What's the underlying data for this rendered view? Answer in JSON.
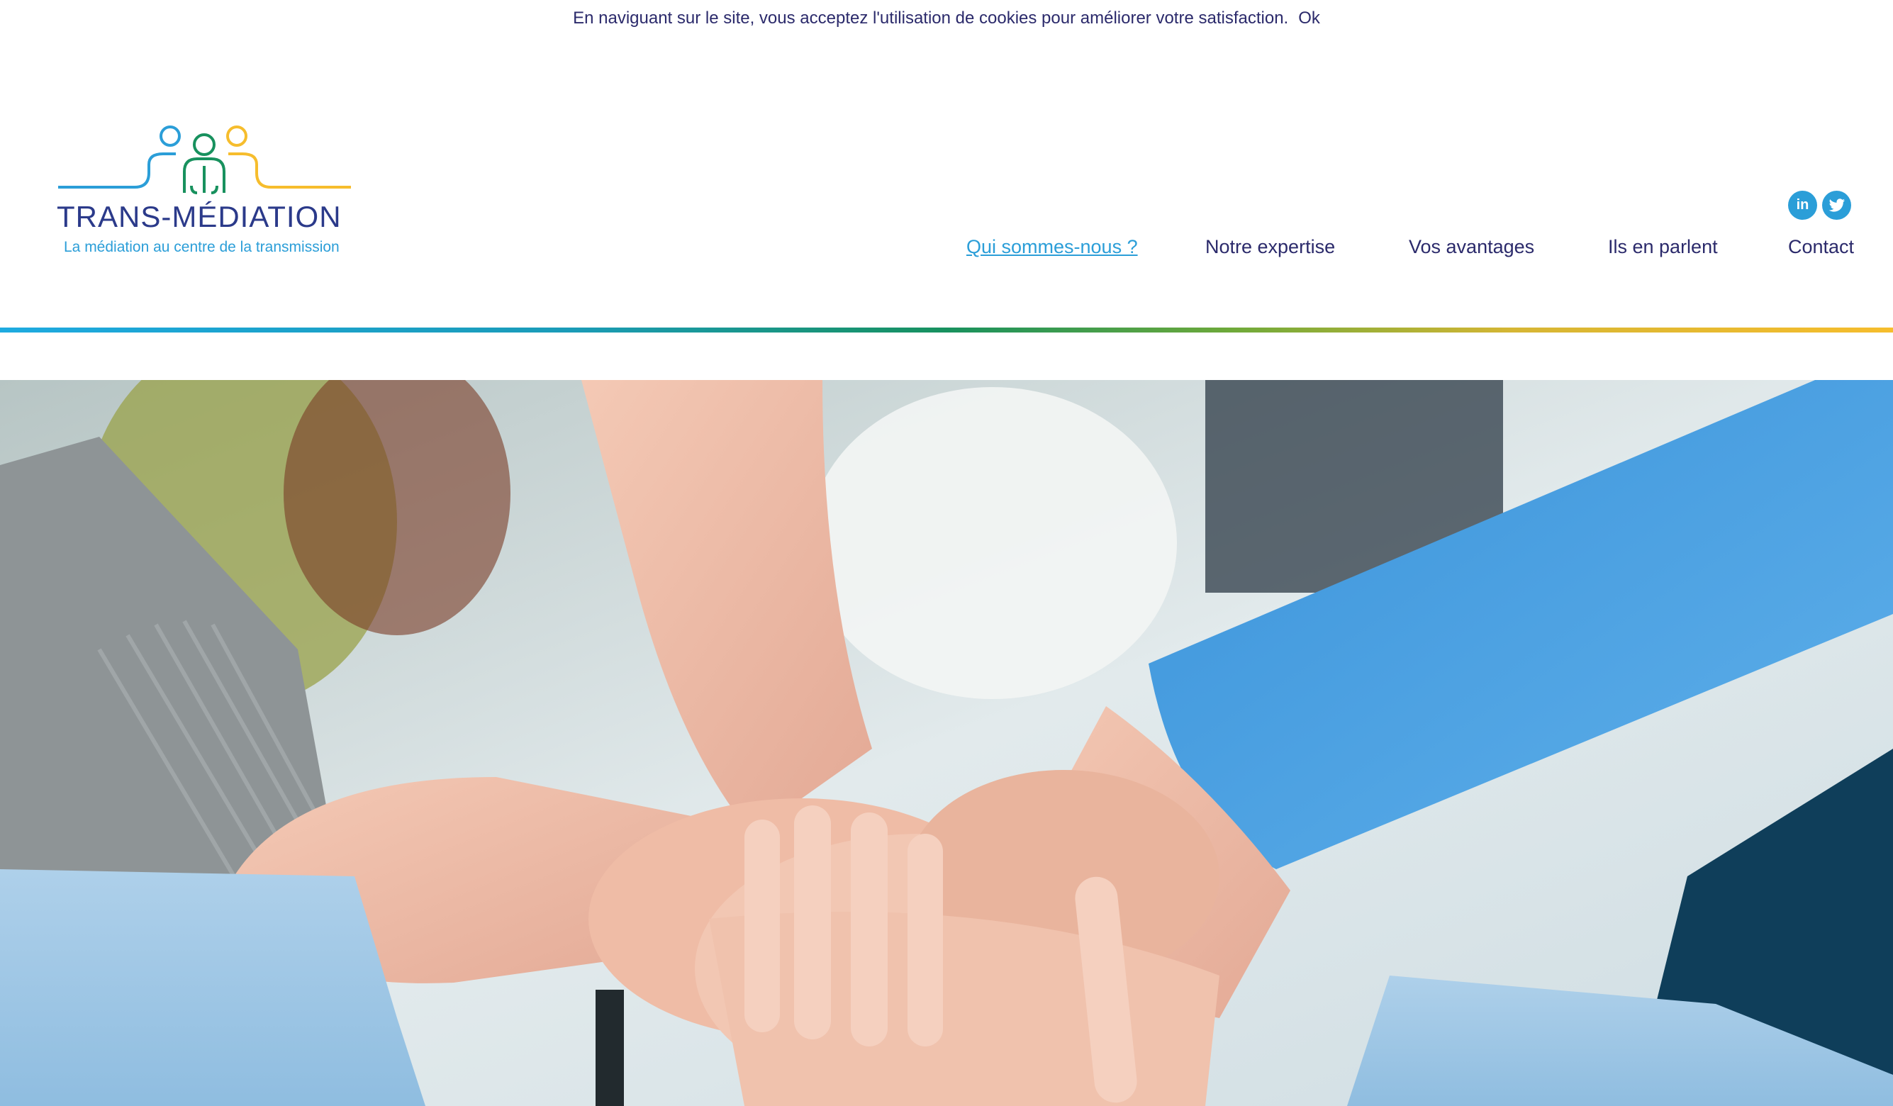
{
  "cookie_banner": {
    "message": "En naviguant sur le site, vous acceptez l'utilisation de cookies pour améliorer votre satisfaction.",
    "ok_label": "Ok"
  },
  "logo": {
    "title": "TRANS-MÉDIATION",
    "tagline": "La médiation au centre de la transmission"
  },
  "social": {
    "linkedin_icon": "linkedin-icon",
    "linkedin_label": "in",
    "twitter_icon": "twitter-icon"
  },
  "nav": {
    "items": [
      {
        "label": "Qui sommes-nous ?",
        "active": true
      },
      {
        "label": "Notre expertise",
        "active": false
      },
      {
        "label": "Vos avantages",
        "active": false
      },
      {
        "label": "Ils en parlent",
        "active": false
      },
      {
        "label": "Contact",
        "active": false
      }
    ]
  },
  "colors": {
    "navy": "#2b2a6b",
    "accent_blue": "#2b9ed8",
    "green": "#18915e",
    "yellow": "#f6bd2d"
  },
  "hero": {
    "image": "hands-stacked-teamwork-photo"
  }
}
